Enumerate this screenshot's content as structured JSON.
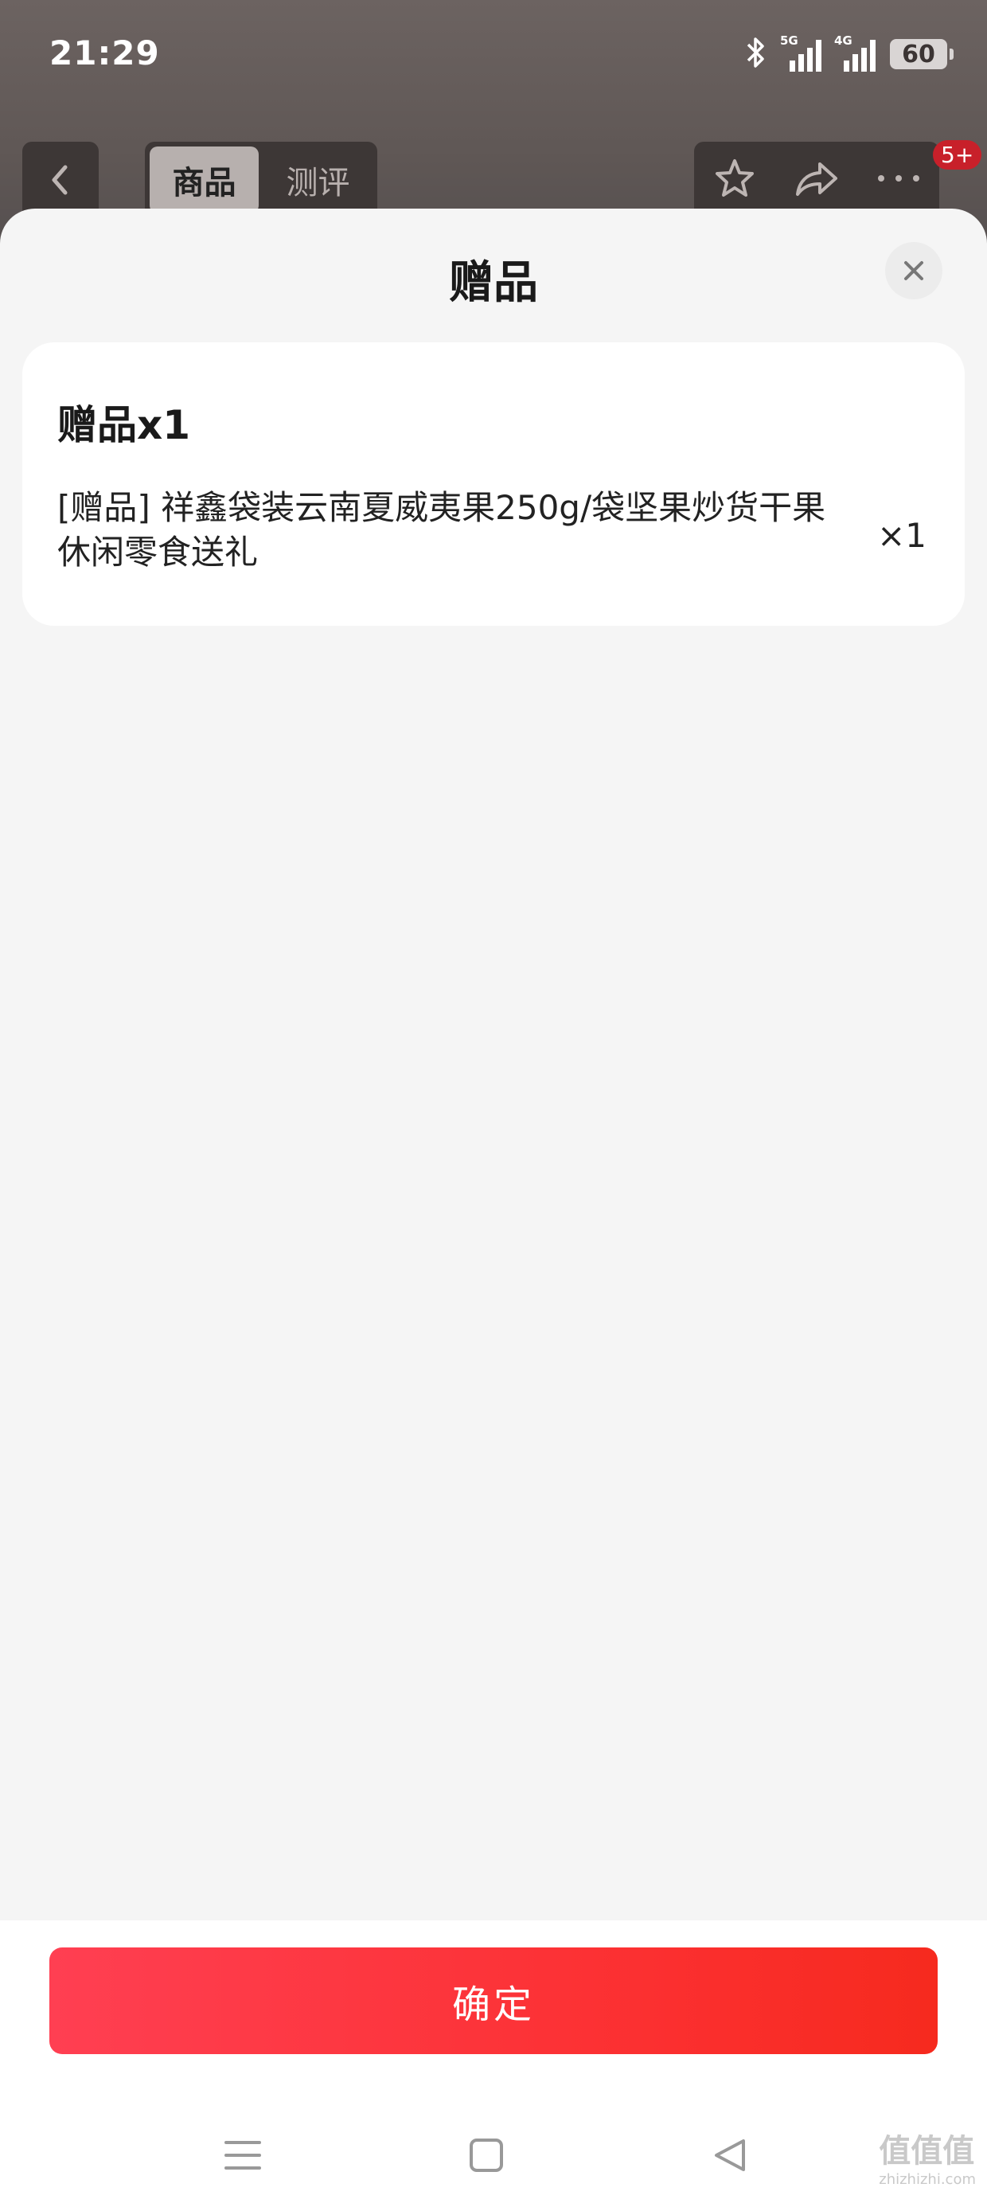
{
  "status_bar": {
    "time": "21:29",
    "network_1": "5G",
    "network_2": "4G",
    "battery": "60"
  },
  "nav": {
    "tabs": [
      "商品",
      "测评"
    ],
    "badge": "5+"
  },
  "sheet": {
    "title": "赠品",
    "gift": {
      "header": "赠品x1",
      "name": "[赠品] 祥鑫袋装云南夏威夷果250g/袋坚果炒货干果休闲零食送礼",
      "quantity": "×1"
    },
    "confirm_label": "确定"
  },
  "watermark": {
    "logo": "值值值",
    "domain": "zhizhizhi.com"
  }
}
